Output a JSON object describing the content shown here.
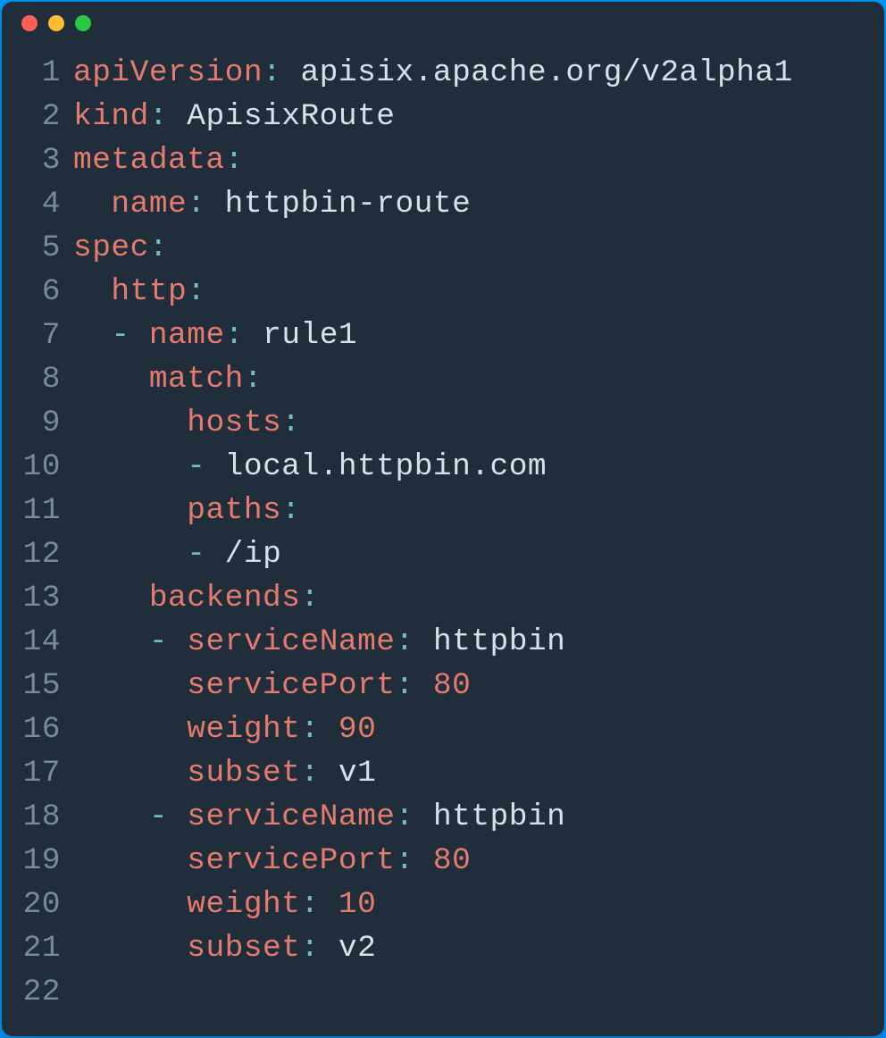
{
  "window": {
    "traffic_colors": {
      "red": "#ff5f57",
      "yellow": "#febc2e",
      "green": "#28c840"
    }
  },
  "code": {
    "lines": [
      {
        "n": "1",
        "tokens": [
          {
            "cls": "tk-key",
            "t": "apiVersion"
          },
          {
            "cls": "tk-colon",
            "t": ":"
          },
          {
            "cls": "tk-val",
            "t": " apisix.apache.org/v2alpha1"
          }
        ]
      },
      {
        "n": "2",
        "tokens": [
          {
            "cls": "tk-key",
            "t": "kind"
          },
          {
            "cls": "tk-colon",
            "t": ":"
          },
          {
            "cls": "tk-val",
            "t": " ApisixRoute"
          }
        ]
      },
      {
        "n": "3",
        "tokens": [
          {
            "cls": "tk-key",
            "t": "metadata"
          },
          {
            "cls": "tk-colon",
            "t": ":"
          }
        ]
      },
      {
        "n": "4",
        "tokens": [
          {
            "cls": "tk-val",
            "t": "  "
          },
          {
            "cls": "tk-key",
            "t": "name"
          },
          {
            "cls": "tk-colon",
            "t": ":"
          },
          {
            "cls": "tk-val",
            "t": " httpbin-route"
          }
        ]
      },
      {
        "n": "5",
        "tokens": [
          {
            "cls": "tk-key",
            "t": "spec"
          },
          {
            "cls": "tk-colon",
            "t": ":"
          }
        ]
      },
      {
        "n": "6",
        "tokens": [
          {
            "cls": "tk-val",
            "t": "  "
          },
          {
            "cls": "tk-key",
            "t": "http"
          },
          {
            "cls": "tk-colon",
            "t": ":"
          }
        ]
      },
      {
        "n": "7",
        "tokens": [
          {
            "cls": "tk-val",
            "t": "  "
          },
          {
            "cls": "tk-dash",
            "t": "-"
          },
          {
            "cls": "tk-val",
            "t": " "
          },
          {
            "cls": "tk-key",
            "t": "name"
          },
          {
            "cls": "tk-colon",
            "t": ":"
          },
          {
            "cls": "tk-val",
            "t": " rule1"
          }
        ]
      },
      {
        "n": "8",
        "tokens": [
          {
            "cls": "tk-val",
            "t": "    "
          },
          {
            "cls": "tk-key",
            "t": "match"
          },
          {
            "cls": "tk-colon",
            "t": ":"
          }
        ]
      },
      {
        "n": "9",
        "tokens": [
          {
            "cls": "tk-val",
            "t": "      "
          },
          {
            "cls": "tk-key",
            "t": "hosts"
          },
          {
            "cls": "tk-colon",
            "t": ":"
          }
        ]
      },
      {
        "n": "10",
        "tokens": [
          {
            "cls": "tk-val",
            "t": "      "
          },
          {
            "cls": "tk-dash",
            "t": "-"
          },
          {
            "cls": "tk-val",
            "t": " local.httpbin.com"
          }
        ]
      },
      {
        "n": "11",
        "tokens": [
          {
            "cls": "tk-val",
            "t": "      "
          },
          {
            "cls": "tk-key",
            "t": "paths"
          },
          {
            "cls": "tk-colon",
            "t": ":"
          }
        ]
      },
      {
        "n": "12",
        "tokens": [
          {
            "cls": "tk-val",
            "t": "      "
          },
          {
            "cls": "tk-dash",
            "t": "-"
          },
          {
            "cls": "tk-val",
            "t": " /ip"
          }
        ]
      },
      {
        "n": "13",
        "tokens": [
          {
            "cls": "tk-val",
            "t": "    "
          },
          {
            "cls": "tk-key",
            "t": "backends"
          },
          {
            "cls": "tk-colon",
            "t": ":"
          }
        ]
      },
      {
        "n": "14",
        "tokens": [
          {
            "cls": "tk-val",
            "t": "    "
          },
          {
            "cls": "tk-dash",
            "t": "-"
          },
          {
            "cls": "tk-val",
            "t": " "
          },
          {
            "cls": "tk-key",
            "t": "serviceName"
          },
          {
            "cls": "tk-colon",
            "t": ":"
          },
          {
            "cls": "tk-val",
            "t": " httpbin"
          }
        ]
      },
      {
        "n": "15",
        "tokens": [
          {
            "cls": "tk-val",
            "t": "      "
          },
          {
            "cls": "tk-key",
            "t": "servicePort"
          },
          {
            "cls": "tk-colon",
            "t": ":"
          },
          {
            "cls": "tk-val",
            "t": " "
          },
          {
            "cls": "tk-num",
            "t": "80"
          }
        ]
      },
      {
        "n": "16",
        "tokens": [
          {
            "cls": "tk-val",
            "t": "      "
          },
          {
            "cls": "tk-key",
            "t": "weight"
          },
          {
            "cls": "tk-colon",
            "t": ":"
          },
          {
            "cls": "tk-val",
            "t": " "
          },
          {
            "cls": "tk-num",
            "t": "90"
          }
        ]
      },
      {
        "n": "17",
        "tokens": [
          {
            "cls": "tk-val",
            "t": "      "
          },
          {
            "cls": "tk-key",
            "t": "subset"
          },
          {
            "cls": "tk-colon",
            "t": ":"
          },
          {
            "cls": "tk-val",
            "t": " v1"
          }
        ]
      },
      {
        "n": "18",
        "tokens": [
          {
            "cls": "tk-val",
            "t": "    "
          },
          {
            "cls": "tk-dash",
            "t": "-"
          },
          {
            "cls": "tk-val",
            "t": " "
          },
          {
            "cls": "tk-key",
            "t": "serviceName"
          },
          {
            "cls": "tk-colon",
            "t": ":"
          },
          {
            "cls": "tk-val",
            "t": " httpbin"
          }
        ]
      },
      {
        "n": "19",
        "tokens": [
          {
            "cls": "tk-val",
            "t": "      "
          },
          {
            "cls": "tk-key",
            "t": "servicePort"
          },
          {
            "cls": "tk-colon",
            "t": ":"
          },
          {
            "cls": "tk-val",
            "t": " "
          },
          {
            "cls": "tk-num",
            "t": "80"
          }
        ]
      },
      {
        "n": "20",
        "tokens": [
          {
            "cls": "tk-val",
            "t": "      "
          },
          {
            "cls": "tk-key",
            "t": "weight"
          },
          {
            "cls": "tk-colon",
            "t": ":"
          },
          {
            "cls": "tk-val",
            "t": " "
          },
          {
            "cls": "tk-num",
            "t": "10"
          }
        ]
      },
      {
        "n": "21",
        "tokens": [
          {
            "cls": "tk-val",
            "t": "      "
          },
          {
            "cls": "tk-key",
            "t": "subset"
          },
          {
            "cls": "tk-colon",
            "t": ":"
          },
          {
            "cls": "tk-val",
            "t": " v2"
          }
        ]
      },
      {
        "n": "22",
        "tokens": []
      }
    ]
  }
}
